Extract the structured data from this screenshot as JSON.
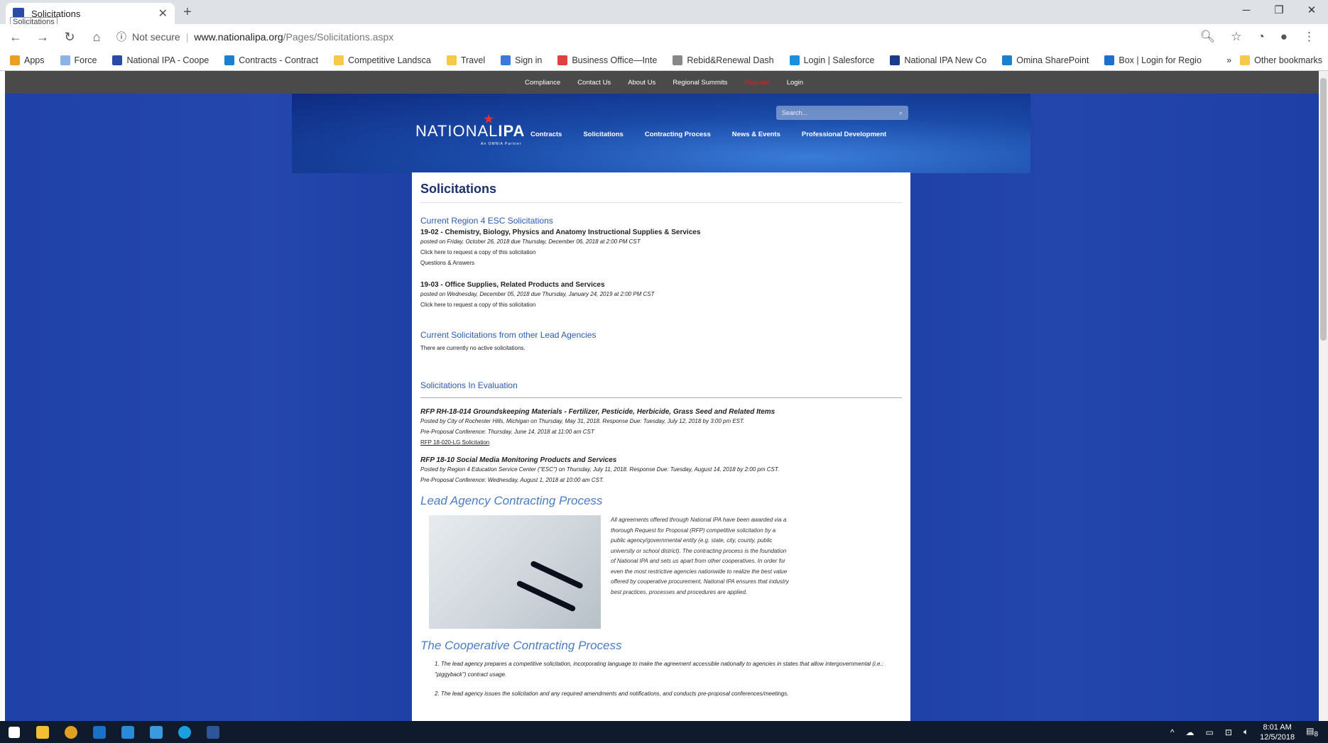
{
  "browser": {
    "tab_title": "Solicitations",
    "tab_tooltip": "Solicitations",
    "security": "Not secure",
    "url_domain": "www.nationalipa.org",
    "url_path": "/Pages/Solicitations.aspx"
  },
  "bookmarks": [
    {
      "label": "Apps",
      "color": "#e8a020"
    },
    {
      "label": "Force",
      "color": "#8ab4e8"
    },
    {
      "label": "National IPA - Coope",
      "color": "#2a4aa8"
    },
    {
      "label": "Contracts - Contract",
      "color": "#1a7fd0"
    },
    {
      "label": "Competitive Landsca",
      "color": "#f7c948"
    },
    {
      "label": "Travel",
      "color": "#f7c948"
    },
    {
      "label": "Sign in",
      "color": "#3b79d8"
    },
    {
      "label": "Business Office—Inte",
      "color": "#e04040"
    },
    {
      "label": "Rebid&Renewal Dash",
      "color": "#888888"
    },
    {
      "label": "Login | Salesforce",
      "color": "#1a8fe0"
    },
    {
      "label": "National IPA New Co",
      "color": "#1a3a8a"
    },
    {
      "label": "Omina SharePoint",
      "color": "#1a7fd0"
    },
    {
      "label": "Box | Login for Regio",
      "color": "#1a6fd0"
    }
  ],
  "bookmarks_more": "»",
  "other_bookmarks": "Other bookmarks",
  "utility_nav": [
    "Compliance",
    "Contact Us",
    "About Us",
    "Regional Summits",
    "Register",
    "Login"
  ],
  "logo": {
    "text_a": "NATIONAL",
    "text_b": "IPA",
    "tagline": "An OMNIA Partner"
  },
  "main_nav": [
    "Contracts",
    "Solicitations",
    "Contracting Process",
    "News & Events",
    "Professional Development"
  ],
  "search_placeholder": "Search...",
  "page": {
    "title": "Solicitations",
    "sec1": "Current Region 4 ESC Solicitations",
    "s1_title": "19-02 - Chemistry, Biology, Physics and Anatomy Instructional Supplies & Services",
    "s1_posted": "posted on Friday, October 26, 2018 due Thursday, December 06, 2018 at 2:00 PM CST",
    "s1_link": "Click here to request a copy of this solicitation",
    "s1_qa": "Questions & Answers",
    "s2_title": "19-03 - Office Supplies, Related Products and Services",
    "s2_posted": "posted on Wednesday, December 05, 2018 due Thursday, January 24, 2019 at 2:00 PM CST",
    "s2_link": "Click here to request a copy of this solicitation",
    "sec2": "Current Solicitations from other Lead Agencies",
    "sec2_text": "There are currently no active solicitations.",
    "sec3": "Solicitations In Evaluation",
    "e1_title": "RFP RH-18-014 Groundskeeping Materials - Fertilizer, Pesticide, Herbicide, Grass Seed and Related Items",
    "e1_posted": "Posted by City of Rochester Hills, Michigan on Thursday, May 31, 2018. Response Due: Tuesday, July 12, 2018 by 3:00 pm EST.",
    "e1_conf": "Pre-Proposal Conference: Thursday, June 14, 2018 at 11:00 am CST",
    "e1_link": "RFP 18-020-LG Solicitation",
    "e2_title": "RFP 18-10 Social Media Monitoring Products and Services",
    "e2_posted": "Posted by Region 4 Education Service Center (\"ESC\") on Thursday, July 11, 2018. Response Due: Tuesday, August 14, 2018 by 2:00 pm CST.",
    "e2_conf": "Pre-Proposal Conference: Wednesday, August 1, 2018 at 10:00 am CST.",
    "lead_head": "Lead Agency Contracting Process",
    "lead_text": "All agreements offered through National IPA have been awarded via a thorough Request for Proposal (RFP) competitive solicitation by a public agency/governmental entity (e.g. state, city, county, public university or school district). The contracting process is the foundation of National IPA and sets us apart from other cooperatives. In order for even the most restrictive agencies nationwide to realize the best value offered by cooperative procurement, National IPA ensures that industry best practices, processes and procedures are applied.",
    "coop_head": "The Cooperative Contracting Process",
    "coop_1": "1. The lead agency prepares a competitive solicitation, incorporating language to make the agreement accessible nationally to agencies in states that allow intergovernmental (i.e.: \"piggyback\") contract usage.",
    "coop_2": "2. The lead agency issues the solicitation and any required amendments and notifications, and conducts pre-proposal conferences/meetings."
  },
  "taskbar": {
    "time": "8:01 AM",
    "date": "12/5/2018",
    "notif": "8"
  }
}
